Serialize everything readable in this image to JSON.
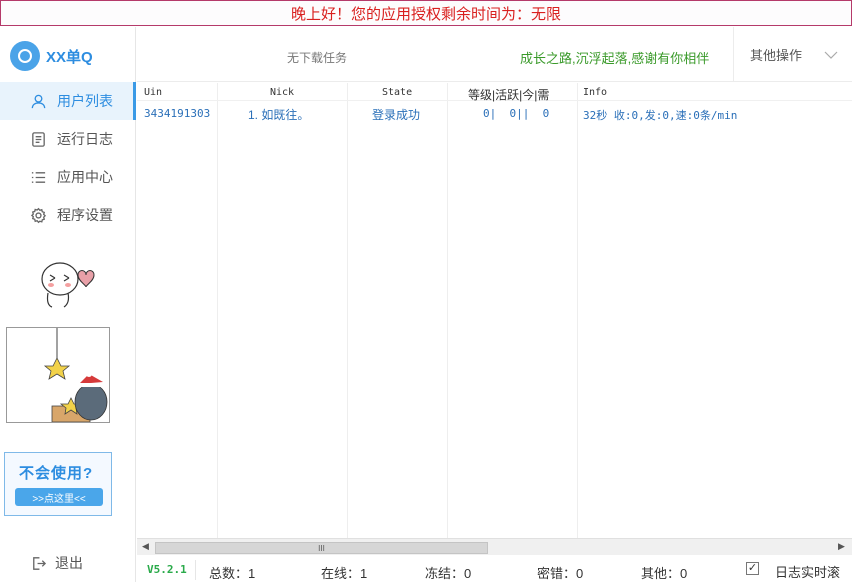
{
  "banner": {
    "text": "晚上好！您的应用授权剩余时间为：无限"
  },
  "app": {
    "logo_text": "XX单Q"
  },
  "sidebar": {
    "items": [
      {
        "label": "用户列表",
        "icon": "user-icon",
        "active": true
      },
      {
        "label": "运行日志",
        "icon": "log-icon",
        "active": false
      },
      {
        "label": "应用中心",
        "icon": "list-icon",
        "active": false
      },
      {
        "label": "程序设置",
        "icon": "gear-icon",
        "active": false
      }
    ],
    "help": {
      "title": "不会使用?",
      "button": ">>点这里<<"
    },
    "logout": "退出"
  },
  "header": {
    "download_status": "无下载任务",
    "slogan": "成长之路,沉浮起落,感谢有你相伴",
    "other_ops": "其他操作"
  },
  "table": {
    "columns": [
      "Uin",
      "Nick",
      "State",
      "等级|活跃|今|需",
      "Info"
    ],
    "rows": [
      {
        "uin": "3434191303",
        "nick": "1. 如既往。",
        "state": "登录成功",
        "level": "0|  0||  0",
        "info": "32秒 收:0,发:0,速:0条/min"
      }
    ]
  },
  "scrollbar": {
    "thumb_grip": "III"
  },
  "status": {
    "version": "V5.2.1",
    "total": "总数：1",
    "online": "在线：1",
    "frozen": "冻结：0",
    "pwd_error": "密错：0",
    "other": "其他：0",
    "log_scroll_label": "日志实时滚动",
    "log_scroll_checked": "✓"
  },
  "colors": {
    "accent": "#2d8de0",
    "banner_text": "#d9201f",
    "slogan": "#3a9a2a"
  }
}
